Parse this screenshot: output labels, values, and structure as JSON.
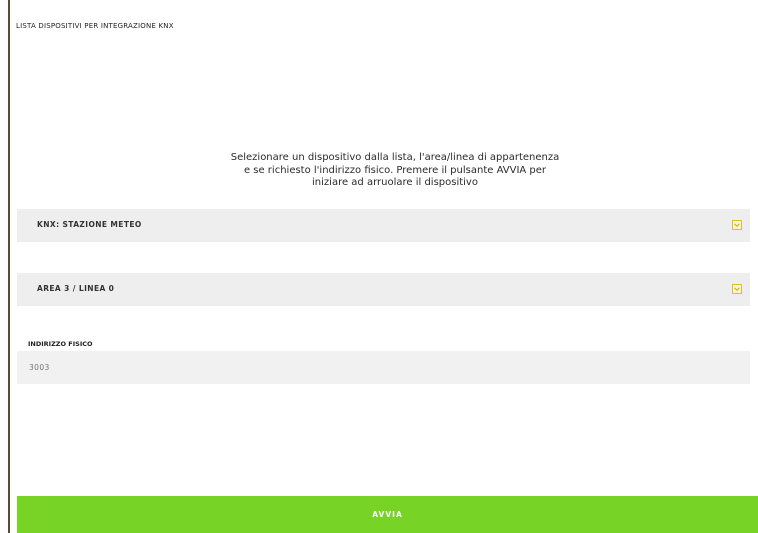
{
  "header": {
    "title": "LISTA DISPOSITIVI PER INTEGRAZIONE KNX"
  },
  "instructions": {
    "lines": [
      "Selezionare un dispositivo dalla lista, l'area/linea di appartenenza",
      "e se richiesto l'indirizzo fisico. Premere il pulsante AVVIA per",
      "iniziare ad arruolare il dispositivo"
    ]
  },
  "device_select": {
    "selected": "KNX: STAZIONE METEO",
    "icon": "chevron-down-icon"
  },
  "area_select": {
    "selected": "AREA 3 / LINEA 0",
    "icon": "chevron-down-icon"
  },
  "physical_address": {
    "label": "INDIRIZZO FISICO",
    "value": "3003"
  },
  "actions": {
    "start_label": "AVVIA"
  },
  "colors": {
    "start_button": "#77d325",
    "chevron_border": "#d9c22a",
    "field_background": "#eeeeee"
  }
}
